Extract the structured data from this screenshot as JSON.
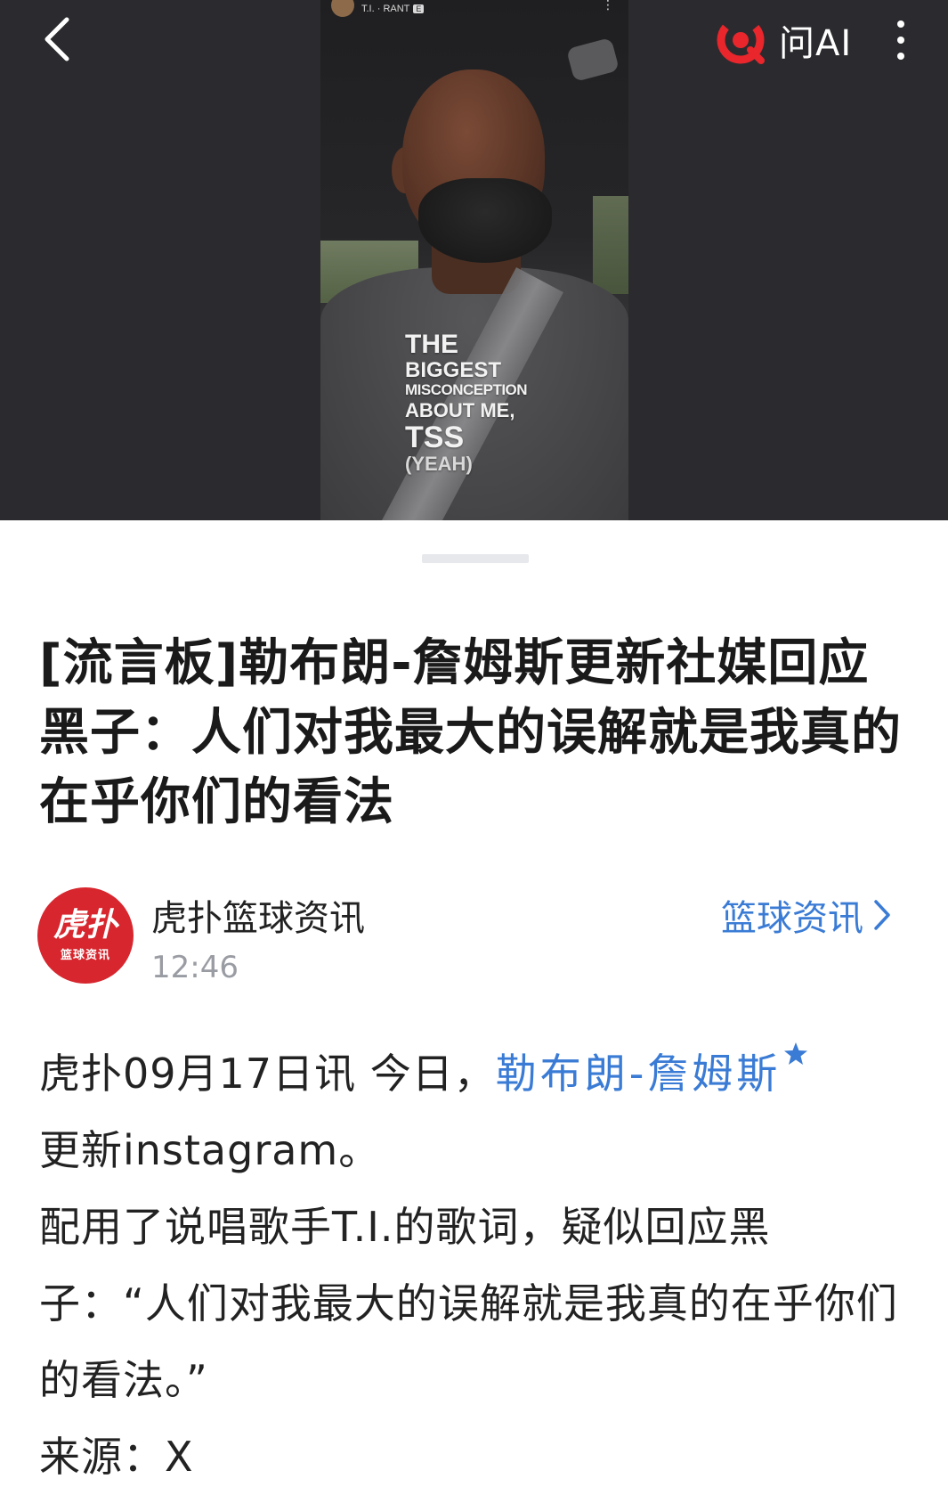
{
  "media": {
    "video_user": "T.I. · RANT",
    "video_badge": "E",
    "overlay": [
      "THE",
      "BIGGEST",
      "MISCONCEPTION",
      "ABOUT ME,",
      "TSS",
      "(YEAH)"
    ]
  },
  "header": {
    "ai_label": "问AI"
  },
  "article": {
    "title": "[流言板]勒布朗-詹姆斯更新社媒回应黑子：人们对我最大的误解就是我真的在乎你们的看法",
    "author": {
      "logo_main": "虎扑",
      "logo_sub": "篮球资讯",
      "name": "虎扑篮球资讯",
      "time": "12:46"
    },
    "category": "篮球资讯",
    "body": {
      "p1_prefix": "虎扑09月17日讯 今日，",
      "player_link": "勒布朗-詹姆斯",
      "p1_suffix": "更新instagram。",
      "p2": "配用了说唱歌手T.I.的歌词，疑似回应黑子：“人们对我最大的误解就是我真的在乎你们的看法。”",
      "p3": "来源：X"
    }
  },
  "colors": {
    "media_bg": "#2b2b2f",
    "accent_blue": "#3a7bd5",
    "brand_red": "#d7262e",
    "time_gray": "#9a9ca3"
  }
}
